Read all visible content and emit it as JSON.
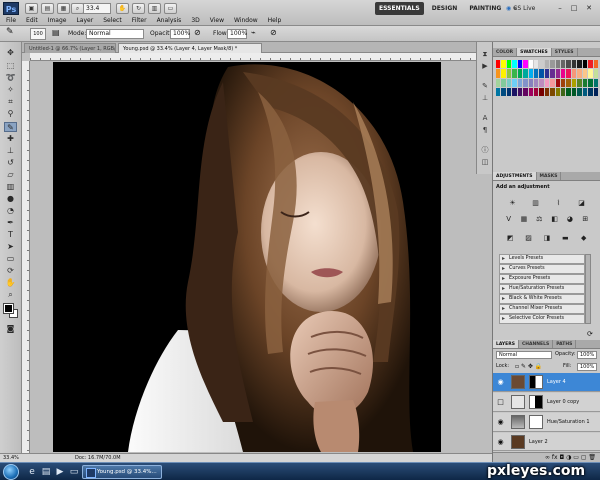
{
  "app": {
    "logo": "Ps",
    "zoom": "33.4",
    "workspaces": [
      "ESSENTIALS",
      "DESIGN",
      "PAINTING"
    ],
    "more": "»",
    "cs_live": "CS Live",
    "window_controls": [
      "–",
      "□",
      "✕"
    ]
  },
  "menu": [
    "File",
    "Edit",
    "Image",
    "Layer",
    "Select",
    "Filter",
    "Analysis",
    "3D",
    "View",
    "Window",
    "Help"
  ],
  "options": {
    "brush_size": "100",
    "mode_label": "Mode:",
    "mode_value": "Normal",
    "opacity_label": "Opacity:",
    "opacity_value": "100%",
    "flow_label": "Flow:",
    "flow_value": "100%"
  },
  "tabs": [
    {
      "label": "Untitled-1 @ 66.7% (Layer 1, RGB/8) *",
      "active": false
    },
    {
      "label": "Young.psd @ 33.4% (Layer 4, Layer Mask/8) *",
      "active": true
    }
  ],
  "status": {
    "zoom": "33.4%",
    "doc": "Doc: 16.7M/70.0M"
  },
  "panels": {
    "swatch_tabs": [
      {
        "label": "COLOR",
        "active": false
      },
      {
        "label": "SWATCHES",
        "active": true
      },
      {
        "label": "STYLES",
        "active": false
      }
    ],
    "swatch_colors": [
      "#ff0000",
      "#ffff00",
      "#00ff00",
      "#00ffff",
      "#0000ff",
      "#ff00ff",
      "#ffffff",
      "#e6e6e6",
      "#cccccc",
      "#b3b3b3",
      "#999999",
      "#808080",
      "#666666",
      "#4d4d4d",
      "#333333",
      "#1a1a1a",
      "#000000",
      "#ee1d24",
      "#f26522",
      "#f7941d",
      "#fff200",
      "#8dc63f",
      "#39b54a",
      "#00a651",
      "#00a99d",
      "#00aeef",
      "#0072bc",
      "#0054a6",
      "#2e3192",
      "#662d91",
      "#92278f",
      "#ec008c",
      "#ed145b",
      "#f69679",
      "#f9ad81",
      "#fdc689",
      "#fff79a",
      "#c4df9b",
      "#a3d39c",
      "#82ca9c",
      "#7accc8",
      "#6dcff6",
      "#7da7d9",
      "#8393ca",
      "#8781bd",
      "#a186be",
      "#bd8cbf",
      "#f49ac1",
      "#f5989d",
      "#9e0b0f",
      "#a0410d",
      "#a36209",
      "#aba000",
      "#598527",
      "#1a7b30",
      "#007236",
      "#00746b",
      "#0076a3",
      "#004b80",
      "#003471",
      "#1b1464",
      "#440e62",
      "#630460",
      "#9e005d",
      "#9e0039",
      "#790000",
      "#7b2e00",
      "#7d4900",
      "#827b00",
      "#406618",
      "#005e20",
      "#005826",
      "#005952",
      "#005b7f",
      "#003663",
      "#002157"
    ],
    "adjust_tabs": [
      {
        "label": "ADJUSTMENTS",
        "active": true
      },
      {
        "label": "MASKS",
        "active": false
      }
    ],
    "adjust_title": "Add an adjustment",
    "presets": [
      "Levels Presets",
      "Curves Presets",
      "Exposure Presets",
      "Hue/Saturation Presets",
      "Black & White Presets",
      "Channel Mixer Presets",
      "Selective Color Presets"
    ],
    "layer_tabs": [
      {
        "label": "LAYERS",
        "active": true
      },
      {
        "label": "CHANNELS",
        "active": false
      },
      {
        "label": "PATHS",
        "active": false
      }
    ],
    "blend_mode": "Normal",
    "opacity_label": "Opacity:",
    "opacity_value": "100%",
    "lock_label": "Lock:",
    "fill_label": "Fill:",
    "fill_value": "100%",
    "layers": [
      {
        "name": "Layer 4",
        "selected": true,
        "visible": true
      },
      {
        "name": "Layer 0 copy",
        "selected": false,
        "visible": false
      },
      {
        "name": "Hue/Saturation 1",
        "selected": false,
        "visible": true
      },
      {
        "name": "Layer 2",
        "selected": false,
        "visible": true
      },
      {
        "name": "Layer 1",
        "selected": false,
        "visible": true
      }
    ]
  },
  "taskbar": {
    "task_label": "Young.psd @ 33.4%..."
  },
  "watermark": "pxleyes.com"
}
